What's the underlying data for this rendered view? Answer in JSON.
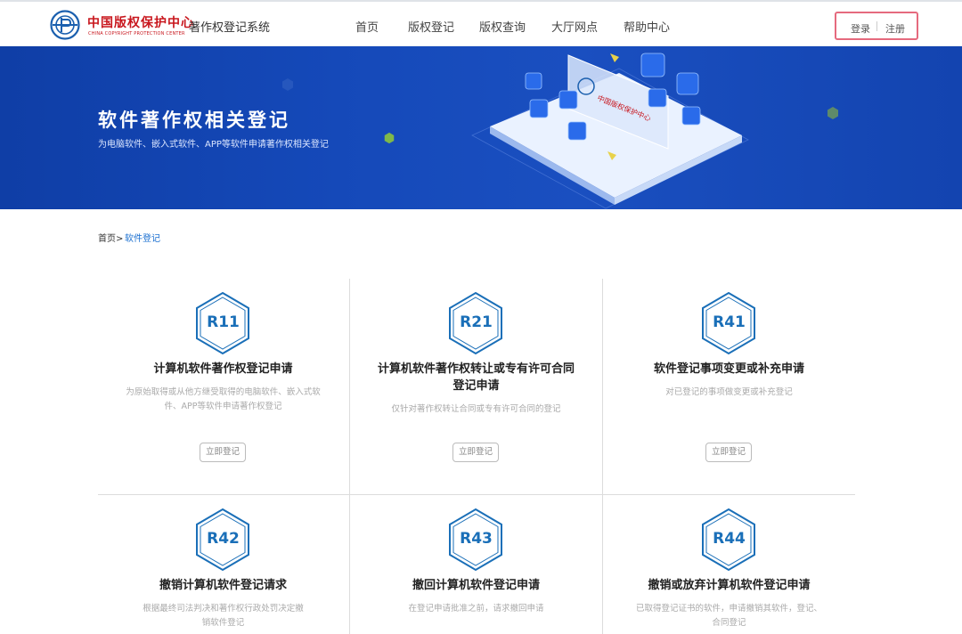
{
  "header": {
    "brand_cn": "中国版权保护中心",
    "brand_en": "CHINA COPYRIGHT PROTECTION CENTER",
    "system_title": "著作权登记系统",
    "nav": [
      "首页",
      "版权登记",
      "版权查询",
      "大厅网点",
      "帮助中心"
    ],
    "login": "登录",
    "register": "注册"
  },
  "banner": {
    "title": "软件著作权相关登记",
    "subtitle": "为电脑软件、嵌入式软件、APP等软件申请著作权相关登记",
    "art_sign": "中国版权保护中心"
  },
  "breadcrumb": {
    "home": "首页>",
    "current": "软件登记"
  },
  "cards": [
    {
      "code": "R11",
      "title": "计算机软件著作权登记申请",
      "desc": "为原始取得或从他方继受取得的电脑软件、嵌入式软件、APP等软件申请著作权登记",
      "button": "立即登记"
    },
    {
      "code": "R21",
      "title": "计算机软件著作权转让或专有许可合同登记申请",
      "desc": "仅针对著作权转让合同或专有许可合同的登记",
      "button": "立即登记"
    },
    {
      "code": "R41",
      "title": "软件登记事项变更或补充申请",
      "desc": "对已登记的事项做变更或补充登记",
      "button": "立即登记"
    },
    {
      "code": "R42",
      "title": "撤销计算机软件登记请求",
      "desc": "根据最终司法判决和著作权行政处罚决定撤销软件登记"
    },
    {
      "code": "R43",
      "title": "撤回计算机软件登记申请",
      "desc": "在登记申请批准之前，请求撤回申请"
    },
    {
      "code": "R44",
      "title": "撤销或放弃计算机软件登记申请",
      "desc": "已取得登记证书的软件，申请撤销其软件，登记、合同登记"
    }
  ],
  "colors": {
    "accent": "#1a6fb8",
    "brand": "#c8161d",
    "banner": "#1549b9",
    "auth_border": "#e56a7e"
  }
}
